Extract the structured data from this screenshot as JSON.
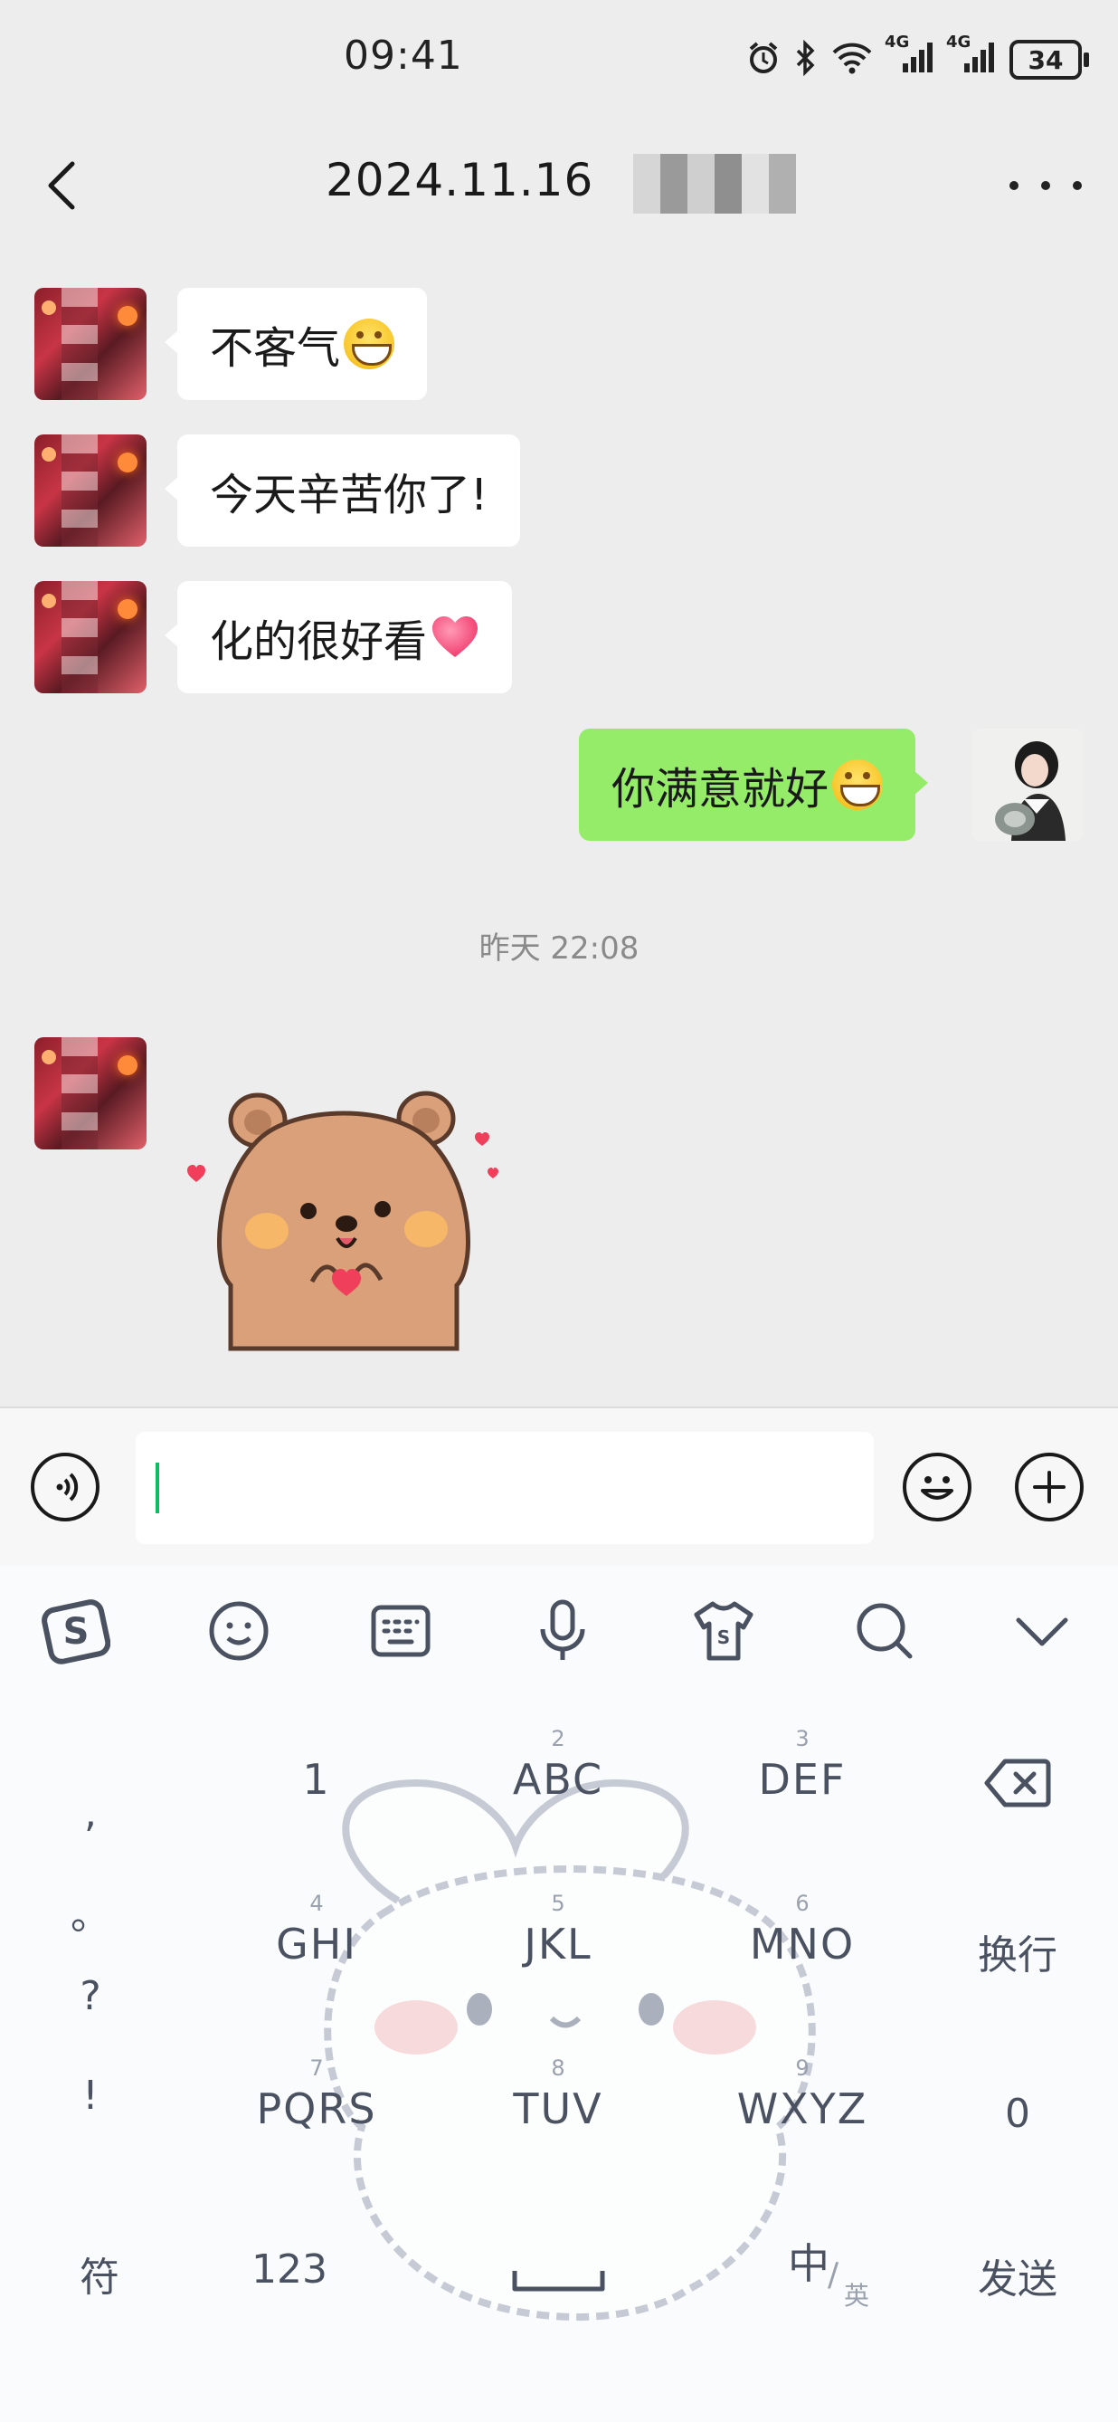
{
  "status_bar": {
    "time": "09:41",
    "network_1": "4G",
    "network_2": "4G",
    "battery": "34"
  },
  "header": {
    "title": "2024.11.16"
  },
  "messages": [
    {
      "sender": "other",
      "text": "不客气"
    },
    {
      "sender": "other",
      "text": "今天辛苦你了!"
    },
    {
      "sender": "other",
      "text": "化的很好看"
    },
    {
      "sender": "me",
      "text": "你满意就好"
    }
  ],
  "timestamp": "昨天 22:08",
  "keyboard": {
    "keys": [
      {
        "sub": "",
        "main": "1"
      },
      {
        "sub": "2",
        "main": "ABC"
      },
      {
        "sub": "3",
        "main": "DEF"
      },
      {
        "sub": "4",
        "main": "GHI"
      },
      {
        "sub": "5",
        "main": "JKL"
      },
      {
        "sub": "6",
        "main": "MNO"
      },
      {
        "sub": "7",
        "main": "PQRS"
      },
      {
        "sub": "8",
        "main": "TUV"
      },
      {
        "sub": "9",
        "main": "WXYZ"
      }
    ],
    "punct": [
      ",",
      "。",
      "?",
      "!"
    ],
    "newline": "换行",
    "zero": "0",
    "symbols": "符",
    "numbers": "123",
    "lang_main": "中",
    "lang_sub": "英",
    "send": "发送"
  },
  "colors": {
    "my_bubble": "#95ec69",
    "other_bubble": "#ffffff",
    "chat_bg": "#ededed",
    "caret": "#07c160"
  }
}
